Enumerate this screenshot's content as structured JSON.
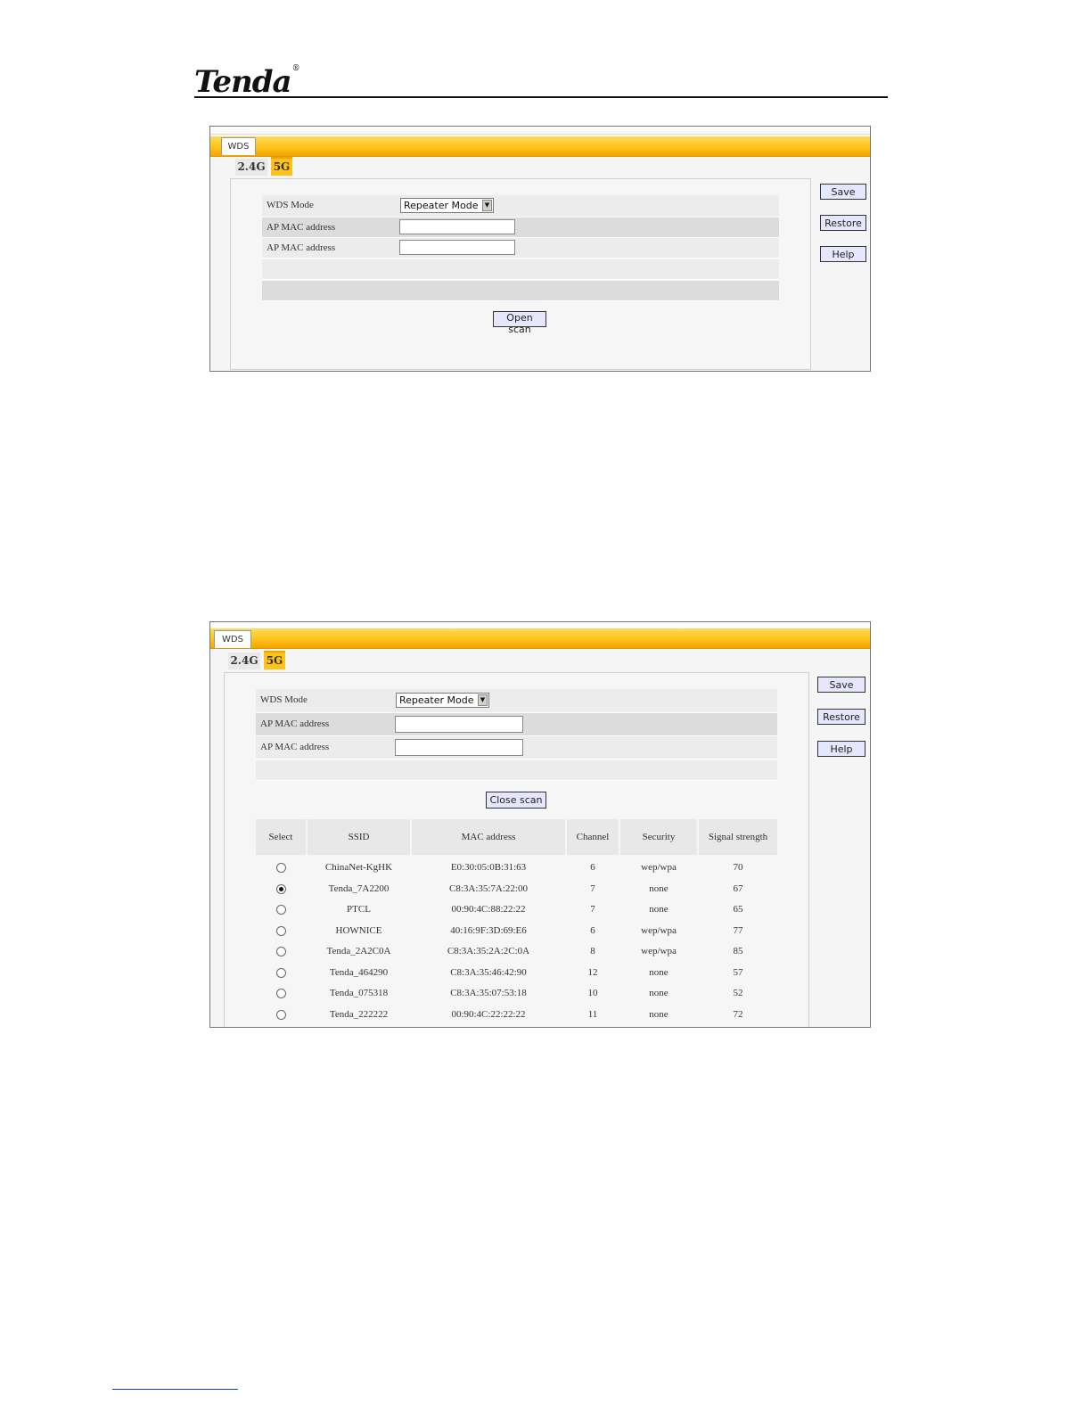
{
  "brand": {
    "logo_text": "Tenda",
    "trademark": "®"
  },
  "screen1": {
    "main_tab": "WDS",
    "subtabs": [
      "2.4G",
      "5G"
    ],
    "wds_mode_label": "WDS Mode",
    "wds_mode_value": "Repeater Mode",
    "ap_mac_label_1": "AP MAC address",
    "ap_mac_label_2": "AP MAC address",
    "ap_mac_value_1": "",
    "ap_mac_value_2": "",
    "scan_button": "Open scan",
    "save_button": "Save",
    "restore_button": "Restore",
    "help_button": "Help"
  },
  "screen2": {
    "main_tab": "WDS",
    "subtabs": [
      "2.4G",
      "5G"
    ],
    "wds_mode_label": "WDS Mode",
    "wds_mode_value": "Repeater Mode",
    "ap_mac_label_1": "AP MAC address",
    "ap_mac_label_2": "AP MAC address",
    "ap_mac_value_1": "",
    "ap_mac_value_2": "",
    "scan_button": "Close scan",
    "save_button": "Save",
    "restore_button": "Restore",
    "help_button": "Help",
    "table": {
      "headers": [
        "Select",
        "SSID",
        "MAC address",
        "Channel",
        "Security",
        "Signal strength"
      ],
      "rows": [
        {
          "selected": false,
          "ssid": "ChinaNet-KgHK",
          "mac": "E0:30:05:0B:31:63",
          "channel": "6",
          "security": "wep/wpa",
          "signal": "70"
        },
        {
          "selected": true,
          "ssid": "Tenda_7A2200",
          "mac": "C8:3A:35:7A:22:00",
          "channel": "7",
          "security": "none",
          "signal": "67"
        },
        {
          "selected": false,
          "ssid": "PTCL",
          "mac": "00:90:4C:88:22:22",
          "channel": "7",
          "security": "none",
          "signal": "65"
        },
        {
          "selected": false,
          "ssid": "HOWNICE",
          "mac": "40:16:9F:3D:69:E6",
          "channel": "6",
          "security": "wep/wpa",
          "signal": "77"
        },
        {
          "selected": false,
          "ssid": "Tenda_2A2C0A",
          "mac": "C8:3A:35:2A:2C:0A",
          "channel": "8",
          "security": "wep/wpa",
          "signal": "85"
        },
        {
          "selected": false,
          "ssid": "Tenda_464290",
          "mac": "C8:3A:35:46:42:90",
          "channel": "12",
          "security": "none",
          "signal": "57"
        },
        {
          "selected": false,
          "ssid": "Tenda_075318",
          "mac": "C8:3A:35:07:53:18",
          "channel": "10",
          "security": "none",
          "signal": "52"
        },
        {
          "selected": false,
          "ssid": "Tenda_222222",
          "mac": "00:90:4C:22:22:22",
          "channel": "11",
          "security": "none",
          "signal": "72"
        }
      ]
    }
  }
}
